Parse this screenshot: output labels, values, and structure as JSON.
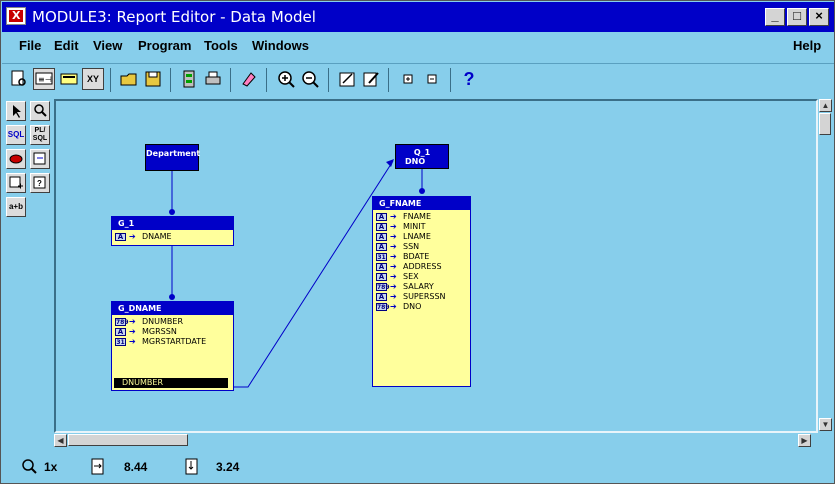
{
  "window": {
    "title": "MODULE3: Report Editor - Data Model"
  },
  "menu": {
    "file": "File",
    "edit": "Edit",
    "view": "View",
    "program": "Program",
    "tools": "Tools",
    "windows": "Windows",
    "help": "Help"
  },
  "palette": {
    "sql": "SQL",
    "plsql": "PL/ SQL",
    "attrib": "a+b"
  },
  "toolbar": {
    "xy": "XY",
    "help": "?"
  },
  "model": {
    "department_query": "Department",
    "q1_query": {
      "name": "Q_1",
      "sub": "DNO"
    },
    "g1": {
      "title": "G_1",
      "columns": [
        {
          "icon": "A",
          "name": "DNAME"
        }
      ]
    },
    "g_dname": {
      "title": "G_DNAME",
      "columns": [
        {
          "icon": "789",
          "name": "DNUMBER"
        },
        {
          "icon": "A",
          "name": "MGRSSN"
        },
        {
          "icon": "31",
          "name": "MGRSTARTDATE"
        }
      ],
      "link_column": "DNUMBER"
    },
    "g_fname": {
      "title": "G_FNAME",
      "columns": [
        {
          "icon": "A",
          "name": "FNAME"
        },
        {
          "icon": "A",
          "name": "MINIT"
        },
        {
          "icon": "A",
          "name": "LNAME"
        },
        {
          "icon": "A",
          "name": "SSN"
        },
        {
          "icon": "31",
          "name": "BDATE"
        },
        {
          "icon": "A",
          "name": "ADDRESS"
        },
        {
          "icon": "A",
          "name": "SEX"
        },
        {
          "icon": "789",
          "name": "SALARY"
        },
        {
          "icon": "A",
          "name": "SUPERSSN"
        },
        {
          "icon": "789",
          "name": "DNO"
        }
      ]
    }
  },
  "status": {
    "zoom": "1x",
    "x": "8.44",
    "y": "3.24"
  }
}
